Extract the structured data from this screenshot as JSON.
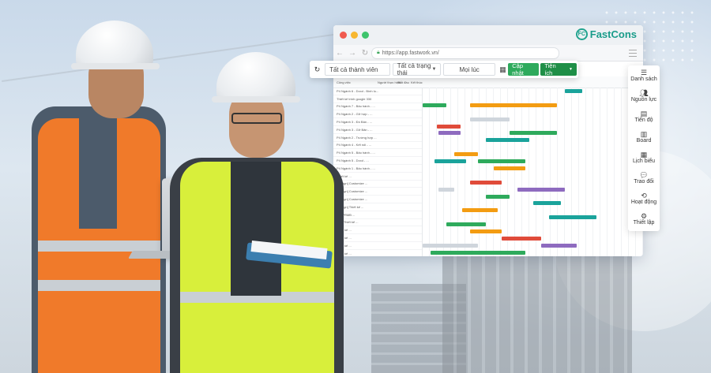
{
  "browser": {
    "brand": "FastCons",
    "brand_mark": "FC",
    "url": "https://app.fastwork.vn/",
    "colors": {
      "brand": "#1a9c8a",
      "green": "#2eaa5c",
      "orange": "#f39c12",
      "red": "#e04b3a",
      "teal": "#1aa39b",
      "purple": "#8e6bbf",
      "gray": "#cfd5dc"
    }
  },
  "toolbar": {
    "members": "Tất cả thành viên",
    "status": "Tất cả trạng thái",
    "time": "Mọi lúc",
    "update_button": "Cập nhật",
    "extension_button": "Tiện ích"
  },
  "side_menu": {
    "items": [
      {
        "label": "Danh sách",
        "icon": "list-icon"
      },
      {
        "label": "Nguồn lực",
        "icon": "users-icon"
      },
      {
        "label": "Tiến độ",
        "icon": "gantt-icon"
      },
      {
        "label": "Board",
        "icon": "board-icon"
      },
      {
        "label": "Lịch biểu",
        "icon": "calendar-icon"
      },
      {
        "label": "Trao đổi",
        "icon": "chat-icon"
      },
      {
        "label": "Hoạt động",
        "icon": "history-icon"
      },
      {
        "label": "Thiết lập",
        "icon": "gear-icon"
      }
    ]
  },
  "gantt": {
    "columns": [
      "Công việc",
      "Người thực hiện",
      "Bắt đầu",
      "Kết thúc"
    ],
    "rows": [
      "P4 Ngành 6 - Dvcd - Bình lu...",
      "Thiết kế trình google 330",
      "P4 Ngành 7 - Bảo hành - ...",
      "P4 Ngành 2 - Gỡ hợp - ...",
      "P4 Ngành 3 - Đồ Bản - ...",
      "P4 Ngành 3 - Gỡ Bản - ...",
      "P4 Ngành 2 - Trường hợp ...",
      "P4 Ngành 4 - Kết nối - ...",
      "P4 Ngành 5 - Bảo hành - ...",
      "P4 Ngành 5 - Dvcd - ...",
      "P4 Ngành 1 - Bảo hành - ...",
      "Thiết kế ...",
      "[Design] Customize ...",
      "[Design] Customize ...",
      "[Design] Customize ...",
      "[Design] Thiết kế ...",
      "[UI] PRMB ...",
      "[UX] Thiết kế ...",
      "Thiết kế ...",
      "Thiết kế ...",
      "Thiết kế ...",
      "Thiết kế ...",
      "Thiết kế ...",
      "Thiết kế ..."
    ]
  }
}
